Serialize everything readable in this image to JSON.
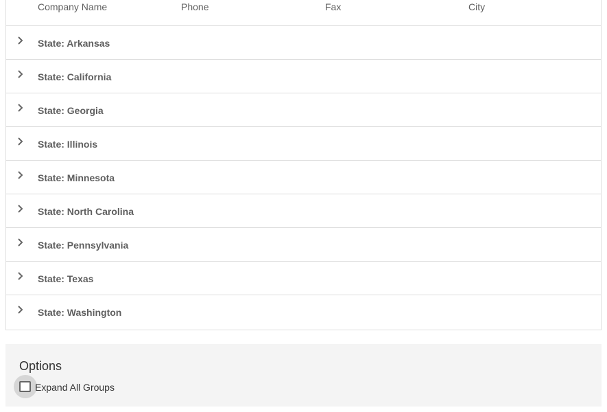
{
  "grid": {
    "columns": [
      "Company Name",
      "Phone",
      "Fax",
      "City"
    ],
    "groups": [
      {
        "label": "State: Arkansas"
      },
      {
        "label": "State: California"
      },
      {
        "label": "State: Georgia"
      },
      {
        "label": "State: Illinois"
      },
      {
        "label": "State: Minnesota"
      },
      {
        "label": "State: North Carolina"
      },
      {
        "label": "State: Pennsylvania"
      },
      {
        "label": "State: Texas"
      },
      {
        "label": "State: Washington"
      }
    ],
    "expand_icon": "chevron-right-icon"
  },
  "options": {
    "title": "Options",
    "expand_all": {
      "label": "Expand All Groups",
      "checked": false
    }
  }
}
